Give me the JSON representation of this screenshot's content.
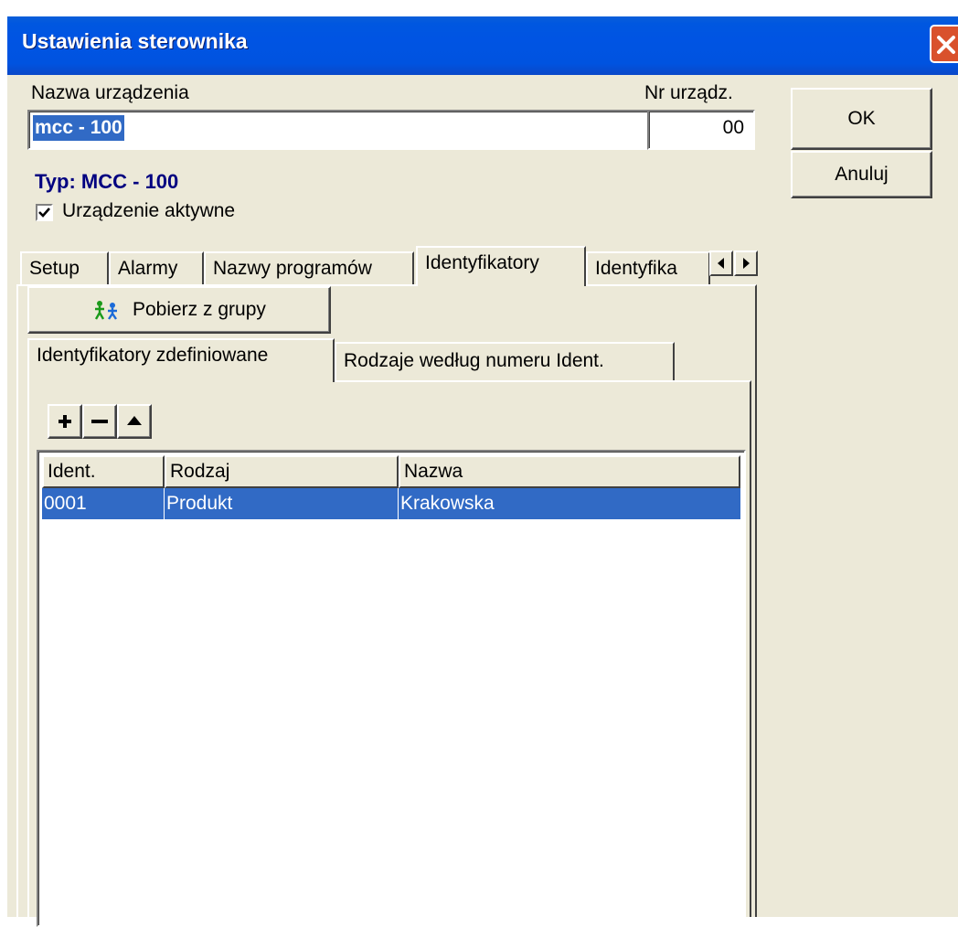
{
  "window": {
    "title": "Ustawienia sterownika"
  },
  "device": {
    "name_label": "Nazwa urządzenia",
    "name_value": "mcc - 100",
    "nr_label": "Nr urządz.",
    "nr_value": "00",
    "type_text": "Typ: MCC - 100",
    "active_label": "Urządzenie aktywne",
    "active_checked": true
  },
  "buttons": {
    "ok": "OK",
    "cancel": "Anuluj"
  },
  "tabs": [
    {
      "label": "Setup"
    },
    {
      "label": "Alarmy"
    },
    {
      "label": "Nazwy programów"
    },
    {
      "label": "Identyfikatory"
    },
    {
      "label": "Identyfika"
    }
  ],
  "active_tab": "Identyfikatory",
  "panel": {
    "fetch_button": "Pobierz z grupy",
    "subtabs": [
      {
        "label": "Identyfikatory zdefiniowane"
      },
      {
        "label": "Rodzaje według numeru Ident."
      }
    ],
    "active_subtab": "Identyfikatory zdefiniowane"
  },
  "table": {
    "columns": [
      "Ident.",
      "Rodzaj",
      "Nazwa"
    ],
    "rows": [
      [
        "0001",
        "Produkt",
        "Krakowska"
      ]
    ]
  },
  "colors": {
    "titlebar": "#0054e3",
    "selection": "#316ac5",
    "type_text": "#000080",
    "dialog_bg": "#ece9d8"
  }
}
